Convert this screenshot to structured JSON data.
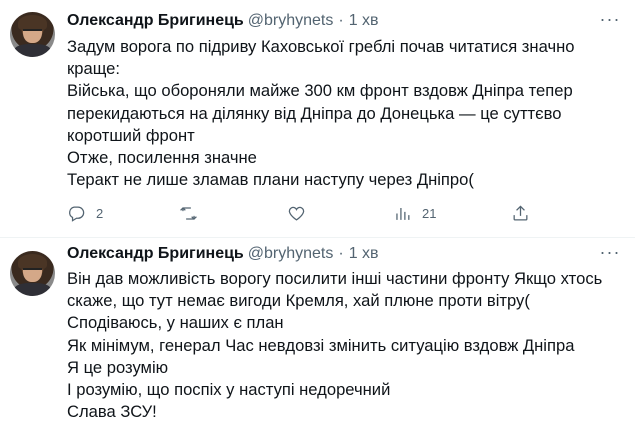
{
  "tweets": [
    {
      "author": {
        "name": "Олександр Бригинець",
        "handle": "@bryhynets",
        "separator": "·",
        "time": "1 хв"
      },
      "lines": [
        "Задум ворога по підриву Каховської греблі почав читатися значно",
        "краще:",
        "Війська, що обороняли майже 300 км фронт вздовж Дніпра тепер",
        "перекидаються на ділянку від Дніпра до Донецька — це суттєво",
        "коротший фронт",
        "Отже, посилення значне",
        "Теракт не лише зламав плани наступу через Дніпро("
      ],
      "actions": {
        "reply_count": "2",
        "retweet_count": "",
        "like_count": "",
        "stats_count": "21"
      },
      "icons": {
        "reply": "reply-icon",
        "retweet": "retweet-icon",
        "like": "heart-icon",
        "stats": "stats-icon",
        "share": "share-icon",
        "more": "more-icon"
      }
    },
    {
      "author": {
        "name": "Олександр Бригинець",
        "handle": "@bryhynets",
        "separator": "·",
        "time": "1 хв"
      },
      "lines": [
        "Він дав можливість ворогу посилити інші частини фронту Якщо хтось",
        "скаже, що тут немає вигоди Кремля, хай плюне проти вітру(",
        "Сподіваюсь, у наших є план",
        "Як мінімум, генерал Час невдовзі змінить ситуацію вздовж Дніпра",
        "Я це розумію",
        "І розумію, що поспіх у наступі недоречний",
        "Слава ЗСУ!"
      ]
    }
  ],
  "colors": {
    "text": "#0f1419",
    "secondary": "#536471",
    "divider": "#eff3f4",
    "background": "#ffffff"
  }
}
